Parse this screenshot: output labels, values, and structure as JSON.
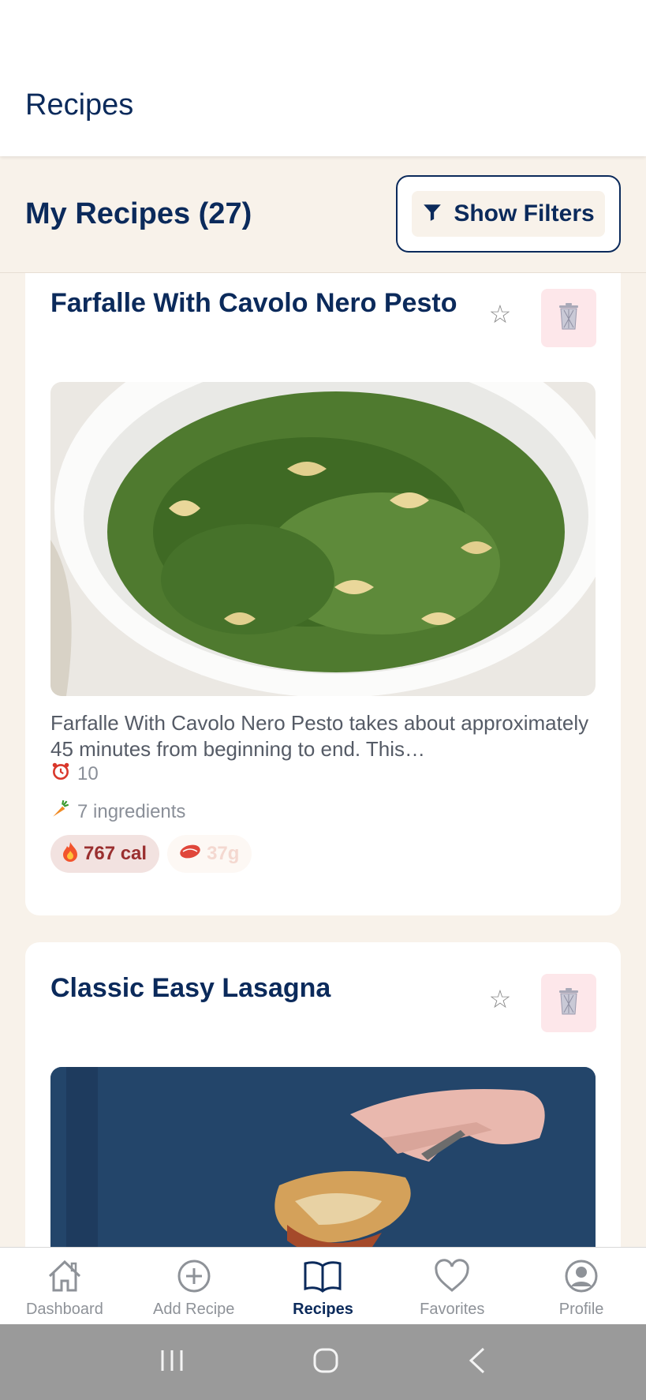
{
  "header": {
    "title": "Recipes"
  },
  "section": {
    "title": "My Recipes (27)",
    "filters_label": "Show Filters"
  },
  "recipes": [
    {
      "title": "Farfalle With Cavolo Nero Pesto",
      "description": "Farfalle With Cavolo Nero Pesto takes about approximately 45 minutes from beginning to end. This…",
      "time": "10",
      "ingredients": "7 ingredients",
      "calories": "767 cal",
      "protein": "37g"
    },
    {
      "title": "Classic Easy Lasagna"
    }
  ],
  "nav": {
    "items": [
      {
        "label": "Dashboard",
        "icon": "home-icon"
      },
      {
        "label": "Add Recipe",
        "icon": "plus-circle-icon"
      },
      {
        "label": "Recipes",
        "icon": "book-icon",
        "active": true
      },
      {
        "label": "Favorites",
        "icon": "heart-icon"
      },
      {
        "label": "Profile",
        "icon": "user-icon"
      }
    ]
  },
  "colors": {
    "primary": "#0b2a5b",
    "background": "#f8f2ea",
    "delete_bg": "#fde7ea",
    "calorie_text": "#9a2f2f"
  }
}
